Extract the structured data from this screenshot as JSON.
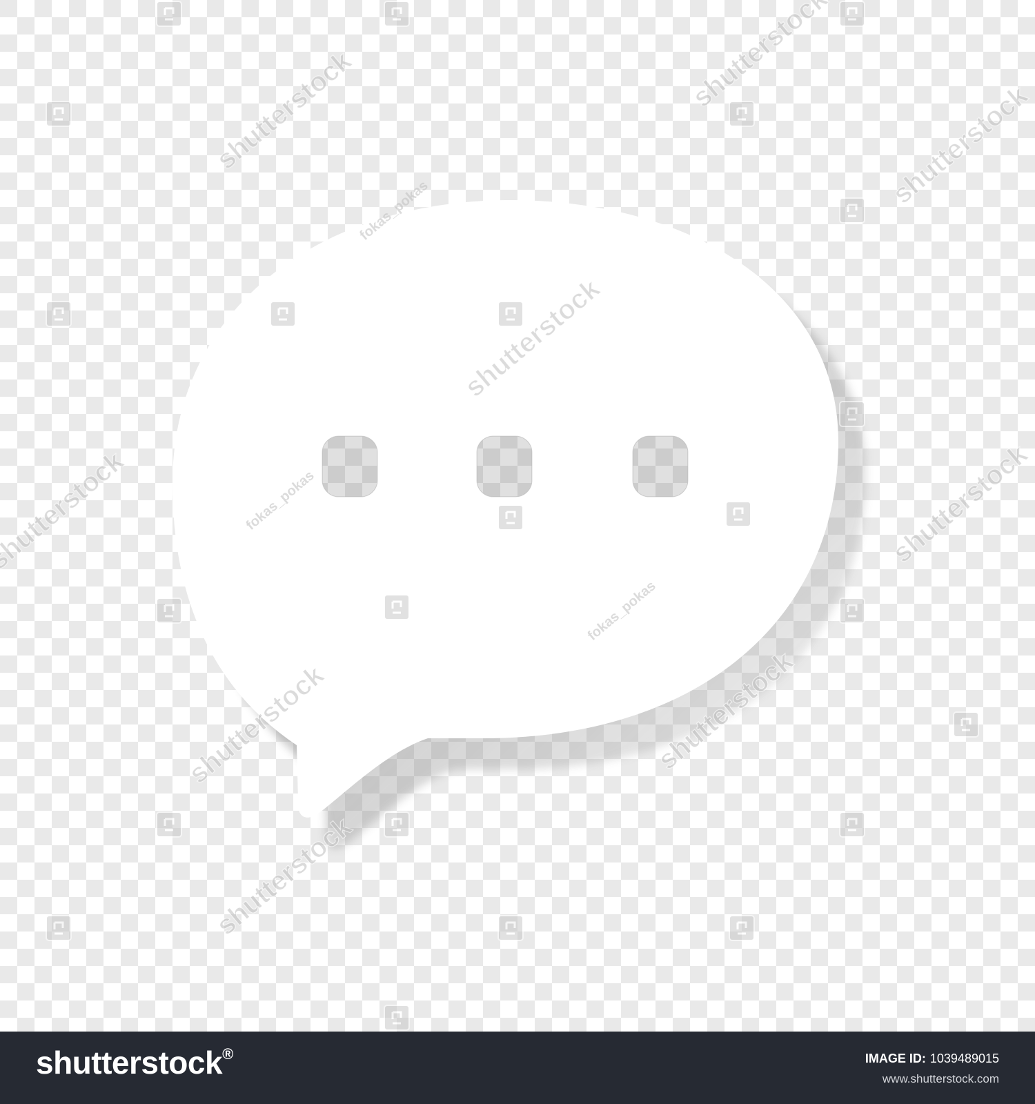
{
  "image": {
    "background": "transparency checkerboard",
    "subject": "speech-bubble-icon",
    "subject_color": "#ffffff",
    "checker_light": "#ffffff",
    "checker_dark": "#e9e9e9",
    "shadow_color": "#6b6b6b",
    "dots_count": 3
  },
  "watermarks": {
    "brand": "shutterstock",
    "contributor": "fokas_pokas"
  },
  "footer": {
    "brand": "shutterstock",
    "brand_suffix": "®",
    "image_id_label": "IMAGE ID:",
    "image_id": "1039489015",
    "site": "www.shutterstock.com",
    "background": "#262a33"
  }
}
